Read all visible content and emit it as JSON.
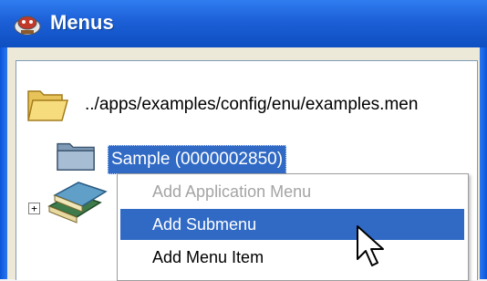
{
  "window": {
    "title": "Menus",
    "title_icon": "menus-app-icon"
  },
  "tree": {
    "root": {
      "icon": "folder-open-icon",
      "label": "../apps/examples/config/enu/examples.men"
    },
    "child": {
      "icon": "folder-closed-icon",
      "label": "Sample (0000002850)"
    },
    "next_node": {
      "expander_glyph": "+",
      "icon": "books-icon"
    }
  },
  "context_menu": {
    "items": [
      {
        "label": "Add Application Menu",
        "state": "disabled"
      },
      {
        "label": "Add Submenu",
        "state": "highlighted"
      },
      {
        "label": "Add Menu Item",
        "state": "enabled"
      }
    ]
  },
  "colors": {
    "titlebar": "#1c5fd6",
    "selection": "#316ac5",
    "disabled_text": "#a4a4a4"
  },
  "cursor": "arrow-cursor-icon"
}
